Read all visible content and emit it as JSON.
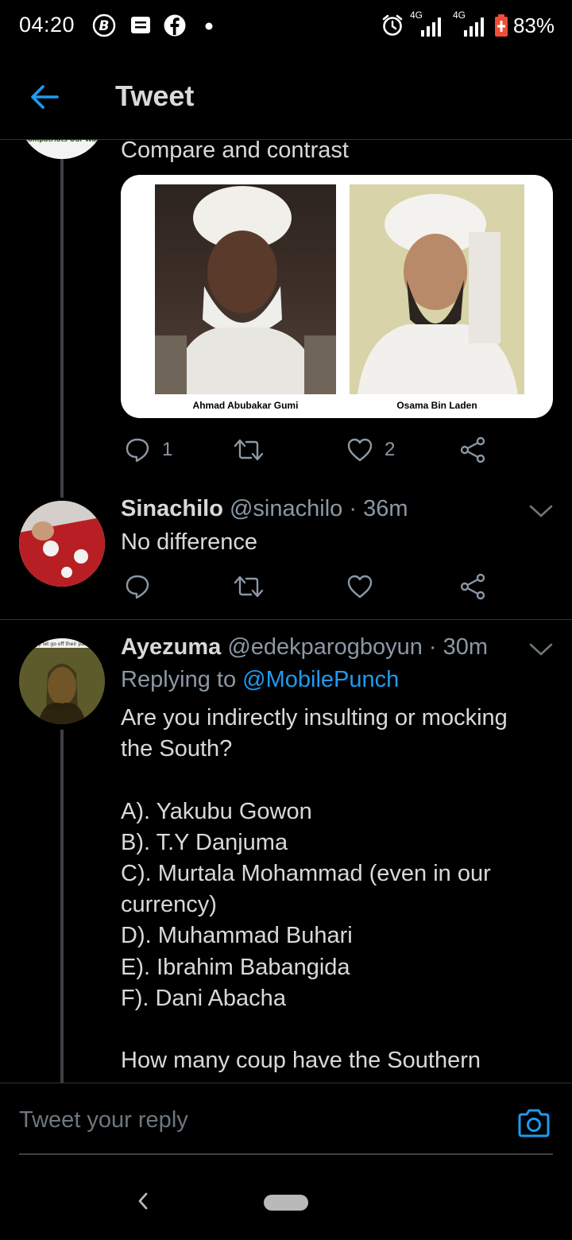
{
  "status_bar": {
    "time": "04:20",
    "network_1": "4G",
    "network_2": "4G",
    "battery": "83%",
    "icons": [
      "b-circle-icon",
      "message-icon",
      "facebook-icon",
      "dot-icon",
      "alarm-icon",
      "signal-icon",
      "battery-icon"
    ]
  },
  "header": {
    "title": "Tweet"
  },
  "parent_tweet": {
    "avatar_text": "Our Compatriots Our Warriors",
    "text": "Compare and contrast",
    "media": {
      "left_caption": "Ahmad Abubakar Gumi",
      "right_caption": "Osama Bin Laden"
    },
    "reply_count": "1",
    "like_count": "2"
  },
  "reply_1": {
    "name": "Sinachilo",
    "handle": "@sinachilo",
    "separator": "·",
    "time": "36m",
    "text": "No difference"
  },
  "reply_2": {
    "avatar_text": "ey let go off their pain",
    "name": "Ayezuma",
    "handle": "@edekparogboyun",
    "separator": "·",
    "time": "30m",
    "replying_prefix": "Replying to",
    "replying_to": "@MobilePunch",
    "lines": [
      "Are you indirectly insulting or mocking",
      "the South?",
      "",
      "A). Yakubu Gowon",
      "B). T.Y Danjuma",
      "C). Murtala Mohammad (even in our",
      "currency)",
      "D). Muhammad Buhari",
      "E). Ibrahim Babangida",
      "F). Dani Abacha",
      "",
      "How many coup have the Southern"
    ]
  },
  "composer": {
    "placeholder": "Tweet your reply"
  },
  "colors": {
    "accent": "#1d9bf0",
    "background": "#000000",
    "muted": "#8b98a5",
    "battery": "#f04e37"
  }
}
